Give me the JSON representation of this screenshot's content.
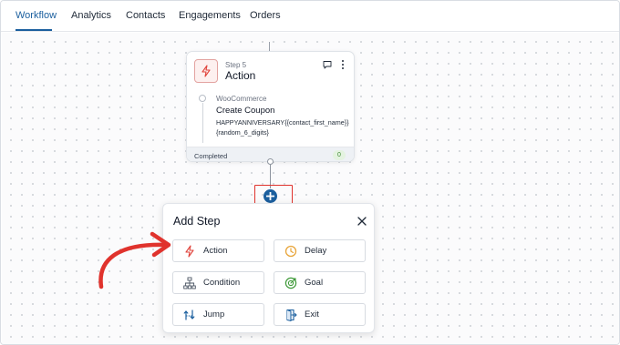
{
  "tabs": [
    {
      "label": "Workflow",
      "active": true
    },
    {
      "label": "Analytics"
    },
    {
      "label": "Contacts"
    },
    {
      "label": "Engagements"
    },
    {
      "label": "Orders"
    }
  ],
  "step_card": {
    "step_number": "Step 5",
    "title": "Action",
    "icon": "lightning-icon",
    "provider": "WooCommerce",
    "action": "Create Coupon",
    "code": "HAPPYANNIVERSARY{{contact_first_name}}{random_6_digits}",
    "status": "Completed",
    "count": "0"
  },
  "add_step": {
    "title": "Add Step",
    "options": [
      {
        "label": "Action",
        "icon": "lightning-icon"
      },
      {
        "label": "Delay",
        "icon": "clock-icon"
      },
      {
        "label": "Condition",
        "icon": "branch-icon"
      },
      {
        "label": "Goal",
        "icon": "target-icon"
      },
      {
        "label": "Jump",
        "icon": "jump-icon"
      },
      {
        "label": "Exit",
        "icon": "exit-door-icon"
      }
    ]
  },
  "colors": {
    "accent": "#1b5f9e",
    "highlight": "#e0332d",
    "action_icon": "#e0443c",
    "delay_icon": "#e8a53a",
    "goal_icon": "#3f9a3a",
    "condition_icon": "#4b5563",
    "jump_icon": "#1b5f9e",
    "exit_icon": "#1b5f9e"
  }
}
